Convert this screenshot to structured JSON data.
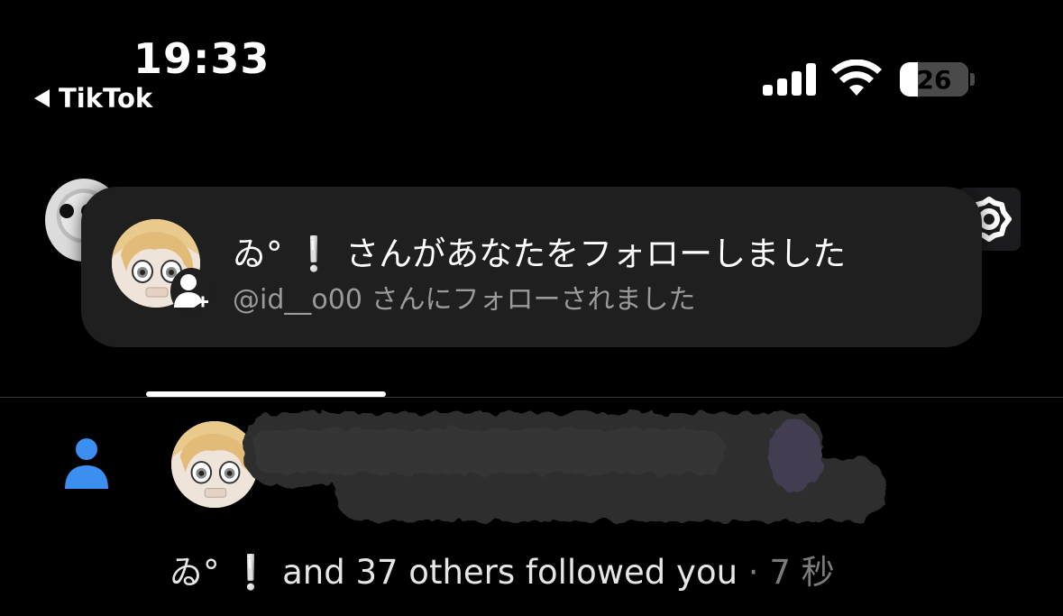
{
  "status_bar": {
    "time": "19:33",
    "back_label": "TikTok",
    "battery": "26"
  },
  "banner": {
    "title": "ゐ° ❕ さんがあなたをフォローしました",
    "subtitle": "@id__o00 さんにフォローされました"
  },
  "notification": {
    "text": "ゐ° ❕  and 37 others followed you",
    "separator": " · ",
    "time_ago": "7 秒"
  },
  "colors": {
    "accent_person_icon": "#3b8ff0",
    "background": "#000000",
    "banner_bg": "#1f1f1f",
    "secondary_text": "#9a9a9a"
  },
  "icons": [
    "back-arrow-icon",
    "cellular-signal-icon",
    "wifi-icon",
    "battery-icon",
    "gear-icon",
    "add-follower-icon",
    "person-icon"
  ]
}
